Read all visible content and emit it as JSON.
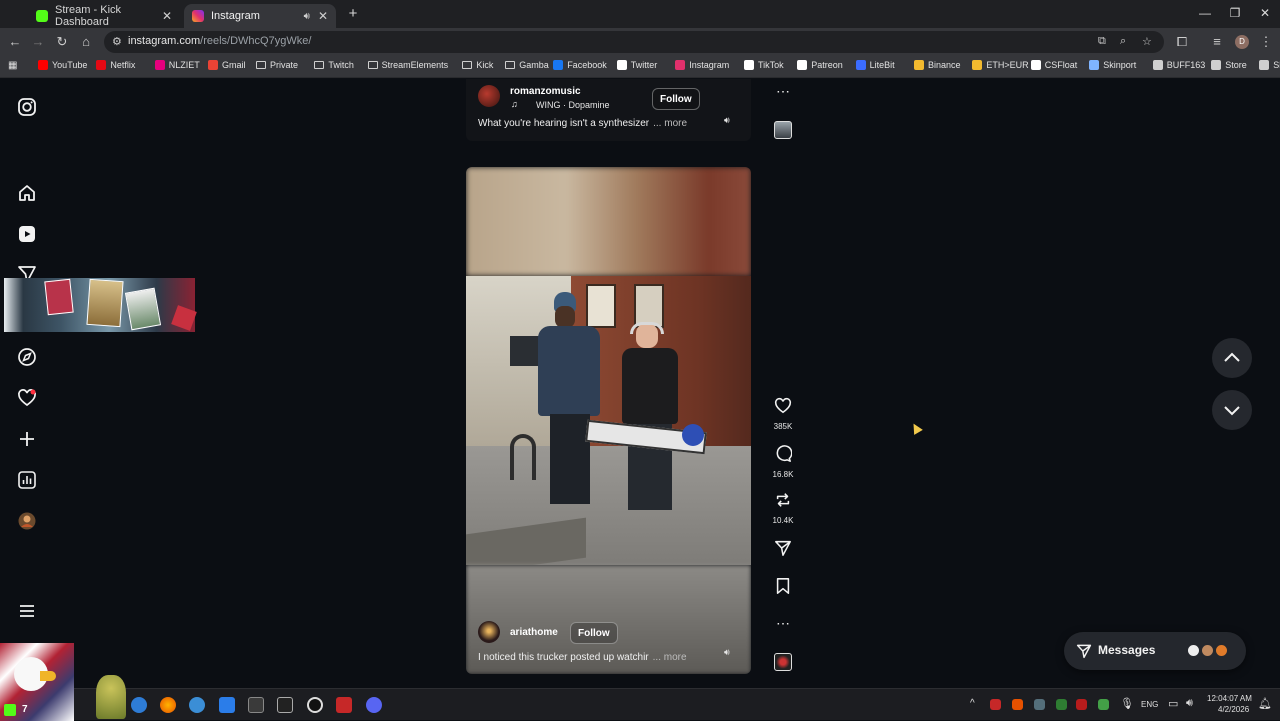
{
  "browser": {
    "tabs": [
      {
        "title": "Stream - Kick Dashboard",
        "active": false
      },
      {
        "title": "Instagram",
        "active": true
      }
    ],
    "new_tab_glyph": "+",
    "address": {
      "domain": "instagram.com",
      "path": "/reels/DWhcQ7ygWke/"
    },
    "bookmarks": [
      {
        "label": "YouTube",
        "icon": "youtube-icon",
        "color": "#ff0000"
      },
      {
        "label": "Netflix",
        "icon": "netflix-icon",
        "color": "#e50914"
      },
      {
        "label": "NLZIET",
        "icon": "nlziet-icon",
        "color": "#e6007e"
      },
      {
        "label": "Gmail",
        "icon": "gmail-icon",
        "color": "#ea4335"
      },
      {
        "label": "Private",
        "icon": "folder-icon",
        "color": "#cfcfcf"
      },
      {
        "label": "Twitch",
        "icon": "folder-icon",
        "color": "#cfcfcf"
      },
      {
        "label": "StreamElements",
        "icon": "folder-icon",
        "color": "#cfcfcf"
      },
      {
        "label": "Kick",
        "icon": "folder-icon",
        "color": "#cfcfcf"
      },
      {
        "label": "Gamba",
        "icon": "folder-icon",
        "color": "#cfcfcf"
      },
      {
        "label": "Facebook",
        "icon": "facebook-icon",
        "color": "#1877f2"
      },
      {
        "label": "Twitter",
        "icon": "x-icon",
        "color": "#ffffff"
      },
      {
        "label": "Instagram",
        "icon": "instagram-icon",
        "color": "#e1306c"
      },
      {
        "label": "TikTok",
        "icon": "tiktok-icon",
        "color": "#ffffff"
      },
      {
        "label": "Patreon",
        "icon": "patreon-icon",
        "color": "#ffffff"
      },
      {
        "label": "LiteBit",
        "icon": "litebit-icon",
        "color": "#3b6cff"
      },
      {
        "label": "Binance",
        "icon": "binance-icon",
        "color": "#f3ba2f"
      },
      {
        "label": "ETH>EUR",
        "icon": "binance-icon",
        "color": "#f3ba2f"
      },
      {
        "label": "CSFloat",
        "icon": "csfloat-icon",
        "color": "#ffffff"
      },
      {
        "label": "Skinport",
        "icon": "skinport-icon",
        "color": "#7fb4ff"
      },
      {
        "label": "BUFF163",
        "icon": "buff-icon",
        "color": "#cfcfcf"
      },
      {
        "label": "Store",
        "icon": "steam-store-icon",
        "color": "#cfcfcf"
      },
      {
        "label": "SkinBaron",
        "icon": "skinbaron-icon",
        "color": "#cfcfcf"
      }
    ]
  },
  "reels": {
    "top": {
      "username": "romanzomusic",
      "audio": "WING · Dopamine",
      "follow_label": "Follow",
      "caption": "What you're hearing isn't a synthesizer",
      "more_label": "... more"
    },
    "current": {
      "username": "ariathome",
      "follow_label": "Follow",
      "caption": "I noticed this trucker posted up watchir",
      "more_label": "... more",
      "likes": "385K",
      "comments": "16.8K",
      "reposts": "10.4K"
    }
  },
  "messages": {
    "label": "Messages"
  },
  "taskbar": {
    "lang": "ENG",
    "time": "12:04:07 AM",
    "date": "4/2/2026",
    "kick_badge": "7"
  },
  "colors": {
    "page_bg": "#0b0e13",
    "accent_like": "#ff3040",
    "kick_green": "#53fc18"
  }
}
